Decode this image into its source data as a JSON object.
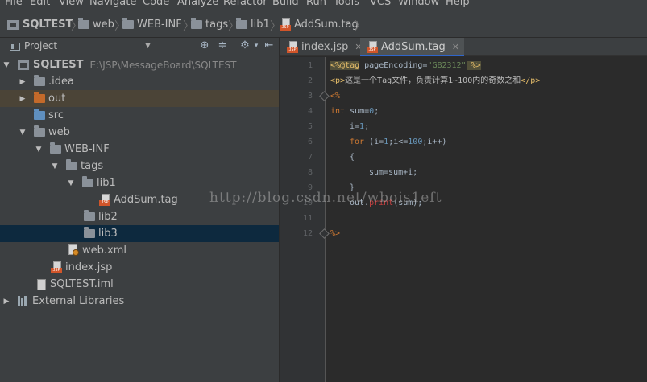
{
  "menu": {
    "items": [
      {
        "mnemonic": "F",
        "rest": "ile"
      },
      {
        "mnemonic": "E",
        "rest": "dit"
      },
      {
        "mnemonic": "V",
        "rest": "iew"
      },
      {
        "mnemonic": "N",
        "rest": "avigate"
      },
      {
        "mnemonic": "C",
        "rest": "ode"
      },
      {
        "mnemonic": "A",
        "rest": "nalyze"
      },
      {
        "mnemonic": "R",
        "rest": "efactor"
      },
      {
        "mnemonic": "B",
        "rest": "uild"
      },
      {
        "mnemonic": "R",
        "rest": "un"
      },
      {
        "mnemonic": "T",
        "rest": "ools"
      },
      {
        "mnemonic": "VC",
        "rest": "S"
      },
      {
        "mnemonic": "W",
        "rest": "indow"
      },
      {
        "mnemonic": "H",
        "rest": "elp"
      }
    ]
  },
  "breadcrumb": [
    "SQLTEST",
    "web",
    "WEB-INF",
    "tags",
    "lib1",
    "AddSum.tag"
  ],
  "project_panel": {
    "title": "Project",
    "tree": [
      {
        "label": "SQLTEST",
        "path": "E:\\JSP\\MessageBoard\\SQLTEST"
      },
      {
        "label": ".idea"
      },
      {
        "label": "out"
      },
      {
        "label": "src"
      },
      {
        "label": "web"
      },
      {
        "label": "WEB-INF"
      },
      {
        "label": "tags"
      },
      {
        "label": "lib1"
      },
      {
        "label": "AddSum.tag"
      },
      {
        "label": "lib2"
      },
      {
        "label": "lib3"
      },
      {
        "label": "web.xml"
      },
      {
        "label": "index.jsp"
      },
      {
        "label": "SQLTEST.iml"
      },
      {
        "label": "External Libraries"
      }
    ]
  },
  "tabs": [
    {
      "label": "index.jsp",
      "icon": "jsp-file-icon"
    },
    {
      "label": "AddSum.tag",
      "icon": "jsp-file-icon",
      "active": true
    }
  ],
  "editor": {
    "line_numbers": [
      "1",
      "2",
      "3",
      "4",
      "5",
      "6",
      "7",
      "8",
      "9",
      "10",
      "11",
      "12"
    ],
    "line1": {
      "open": "<%@",
      "name": "tag",
      "attr": " pageEncoding=",
      "val": "\"GB2312\"",
      "close": " %>"
    },
    "line2": {
      "open": "<p>",
      "text": "这是一个Tag文件，负责计算1~100内的奇数之和",
      "close": "</p>"
    },
    "line3": "<%",
    "line4": {
      "kw": "int",
      "mid": " sum=",
      "num": "0",
      "end": ";"
    },
    "line5": {
      "a": "i=",
      "num": "1",
      "end": ";"
    },
    "line6": {
      "kw": "for",
      "a": " (i=",
      "n1": "1",
      "b": ";i<=",
      "n2": "100",
      "c": ";i++)"
    },
    "line7": "{",
    "line8": "sum=sum+i;",
    "line9": "}",
    "line10": {
      "a": "out.",
      "m": "print",
      "b": "(sum);"
    },
    "line12": "%>"
  },
  "watermark": "http://blog.csdn.net/wbois1eft"
}
